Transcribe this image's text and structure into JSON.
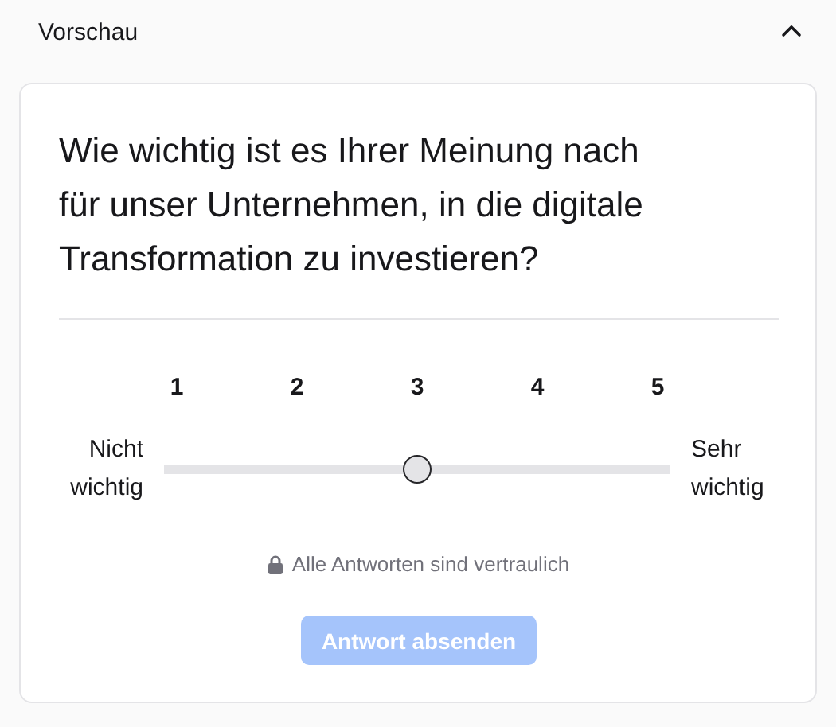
{
  "section": {
    "title": "Vorschau",
    "expanded": true
  },
  "question": "Wie wichtig ist es Ihrer Meinung nach für unser Unternehmen, in die digitale Transformation zu investieren?",
  "scale": {
    "ticks": [
      "1",
      "2",
      "3",
      "4",
      "5"
    ],
    "min_label": "Nicht wichtig",
    "max_label": "Sehr wichtig",
    "level": 0.5
  },
  "note": "Alle Antworten sind vertraulich",
  "submit": {
    "label": "Antwort absenden",
    "disabled": true
  }
}
